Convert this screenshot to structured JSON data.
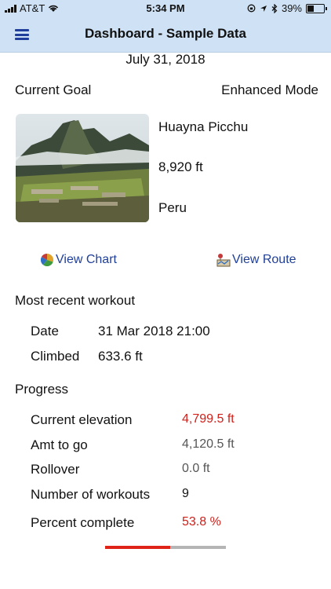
{
  "status": {
    "carrier": "AT&T",
    "time": "5:34 PM",
    "battery": "39%"
  },
  "nav": {
    "title": "Dashboard - Sample Data",
    "menu_icon": "hamburger-menu-icon"
  },
  "date": "July 31, 2018",
  "goal": {
    "header_left": "Current Goal",
    "header_right": "Enhanced Mode",
    "name": "Huayna Picchu",
    "elevation": "8,920 ft",
    "country": "Peru"
  },
  "links": {
    "chart": "View Chart",
    "route": "View Route"
  },
  "recent": {
    "title": "Most recent workout",
    "date_label": "Date",
    "date_value": "31 Mar 2018 21:00",
    "climbed_label": "Climbed",
    "climbed_value": "633.6 ft"
  },
  "progress": {
    "title": "Progress",
    "rows": [
      {
        "label": "Current elevation",
        "value": "4,799.5 ft"
      },
      {
        "label": "Amt to go",
        "value": "4,120.5 ft"
      },
      {
        "label": "Rollover",
        "value": "0.0 ft"
      },
      {
        "label": "Number of workouts",
        "value": "9"
      },
      {
        "label": "Percent complete",
        "value": "53.8 %"
      }
    ],
    "percent": 53.8
  },
  "colors": {
    "accent": "#1f3f9a",
    "red": "#d0201a",
    "navbar": "#cfe2f5"
  }
}
